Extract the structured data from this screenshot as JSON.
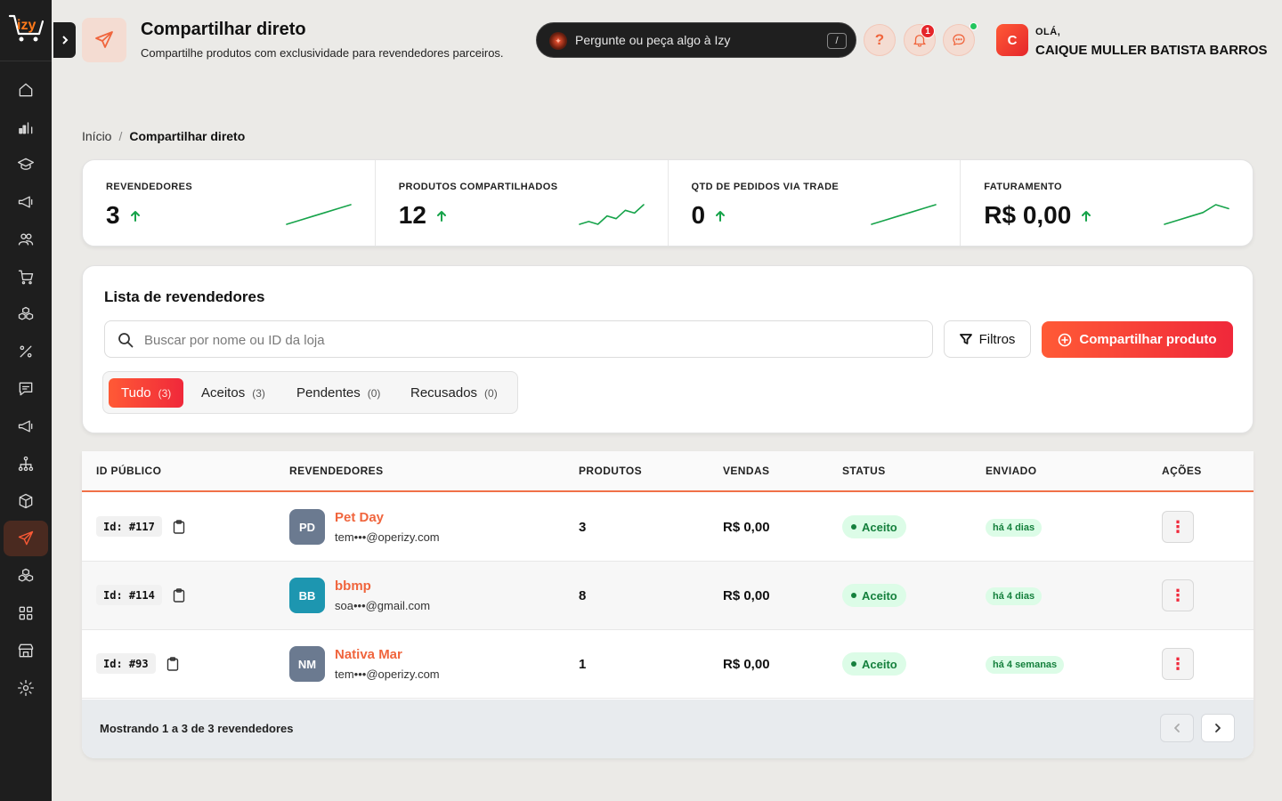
{
  "brand": {
    "logo_text": "izy",
    "accent": "#ff5a36"
  },
  "sidebar": {
    "items": [
      {
        "name": "home-icon"
      },
      {
        "name": "chart-icon"
      },
      {
        "name": "graduation-cap-icon"
      },
      {
        "name": "megaphone-icon"
      },
      {
        "name": "users-icon"
      },
      {
        "name": "cart-icon"
      },
      {
        "name": "boxes-icon"
      },
      {
        "name": "percent-icon"
      },
      {
        "name": "message-icon"
      },
      {
        "name": "megaphone-icon"
      },
      {
        "name": "network-icon"
      },
      {
        "name": "package-icon"
      },
      {
        "name": "send-icon",
        "active": true
      },
      {
        "name": "boxes-icon"
      },
      {
        "name": "grid-icon"
      },
      {
        "name": "store-icon"
      },
      {
        "name": "gear-icon"
      }
    ]
  },
  "header": {
    "title": "Compartilhar direto",
    "subtitle": "Compartilhe produtos com exclusividade para revendedores parceiros.",
    "ai_search_placeholder": "Pergunte ou peça algo à Izy",
    "ai_shortcut": "/",
    "help_label": "?",
    "notification_count": "1",
    "user": {
      "initial": "C",
      "greeting": "OLÁ,",
      "name": "CAIQUE MULLER BATISTA BARROS"
    }
  },
  "breadcrumb": {
    "home": "Início",
    "separator": "/",
    "current": "Compartilhar direto"
  },
  "stats": [
    {
      "label": "REVENDEDORES",
      "value": "3",
      "trend": [
        2,
        3,
        4,
        5,
        6,
        7
      ]
    },
    {
      "label": "PRODUTOS COMPARTILHADOS",
      "value": "12",
      "trend": [
        2,
        3,
        2,
        5,
        4,
        7,
        6,
        9
      ]
    },
    {
      "label": "QTD DE PEDIDOS VIA TRADE",
      "value": "0",
      "trend": [
        2,
        3,
        4,
        5,
        6,
        7
      ]
    },
    {
      "label": "FATURAMENTO",
      "value": "R$ 0,00",
      "trend": [
        2,
        3,
        4,
        5,
        7,
        6
      ]
    }
  ],
  "list": {
    "title": "Lista de revendedores",
    "search_placeholder": "Buscar por nome ou ID da loja",
    "filter_label": "Filtros",
    "share_label": "Compartilhar produto",
    "tabs": [
      {
        "label": "Tudo",
        "count": "(3)",
        "active": true
      },
      {
        "label": "Aceitos",
        "count": "(3)"
      },
      {
        "label": "Pendentes",
        "count": "(0)"
      },
      {
        "label": "Recusados",
        "count": "(0)"
      }
    ]
  },
  "table": {
    "headers": [
      "ID PÚBLICO",
      "REVENDEDORES",
      "PRODUTOS",
      "VENDAS",
      "STATUS",
      "ENVIADO",
      "AÇÕES"
    ],
    "rows": [
      {
        "id": "Id: #117",
        "initials": "PD",
        "avatar_color": "#6b7a90",
        "name": "Pet Day",
        "email": "tem•••@operizy.com",
        "products": "3",
        "sales": "R$ 0,00",
        "status": "Aceito",
        "sent": "há 4 dias",
        "action": "⋮"
      },
      {
        "id": "Id: #114",
        "initials": "BB",
        "avatar_color": "#1d96b0",
        "name": "bbmp",
        "email": "soa•••@gmail.com",
        "products": "8",
        "sales": "R$ 0,00",
        "status": "Aceito",
        "sent": "há 4 dias",
        "action": "⋮"
      },
      {
        "id": "Id: #93",
        "initials": "NM",
        "avatar_color": "#6b7a90",
        "name": "Nativa Mar",
        "email": "tem•••@operizy.com",
        "products": "1",
        "sales": "R$ 0,00",
        "status": "Aceito",
        "sent": "há 4 semanas",
        "action": "⋮"
      }
    ],
    "footer": "Mostrando 1 a 3 de 3 revendedores"
  }
}
